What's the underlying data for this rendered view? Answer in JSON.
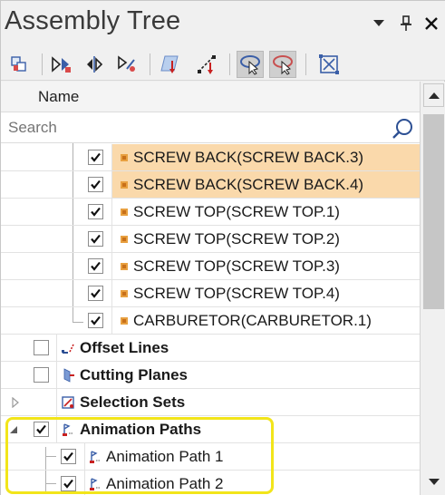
{
  "window": {
    "title": "Assembly Tree",
    "menu_icon": "dropdown-arrow-icon",
    "pin_icon": "pin-icon",
    "close_icon": "close-icon"
  },
  "toolbar": {
    "tools": [
      "isolate-parts-icon",
      "next-level-icon",
      "move-parts-icon",
      "tree-options-icon",
      "plane-section-icon",
      "path-points-icon",
      "select-mode-icon",
      "deselect-mode-icon",
      "fit-view-icon"
    ]
  },
  "tree": {
    "column_header": "Name",
    "search_placeholder": "Search",
    "rows": [
      {
        "label": "SCREW BACK(SCREW BACK.3)",
        "checked": true,
        "highlighted": true
      },
      {
        "label": "SCREW BACK(SCREW BACK.4)",
        "checked": true,
        "highlighted": true
      },
      {
        "label": "SCREW TOP(SCREW TOP.1)",
        "checked": true,
        "highlighted": false
      },
      {
        "label": "SCREW TOP(SCREW TOP.2)",
        "checked": true,
        "highlighted": false
      },
      {
        "label": "SCREW TOP(SCREW TOP.3)",
        "checked": true,
        "highlighted": false
      },
      {
        "label": "SCREW TOP(SCREW TOP.4)",
        "checked": true,
        "highlighted": false
      },
      {
        "label": "CARBURETOR(CARBURETOR.1)",
        "checked": true,
        "highlighted": false
      },
      {
        "label": "Offset Lines",
        "checked": false
      },
      {
        "label": "Cutting Planes",
        "checked": false
      },
      {
        "label": "Selection Sets"
      },
      {
        "label": "Animation Paths",
        "checked": true,
        "expanded": true
      },
      {
        "label": "Animation Path 1",
        "checked": true
      },
      {
        "label": "Animation Path 2",
        "checked": true
      }
    ]
  },
  "colors": {
    "selection_highlight": "#fad9ab",
    "callout_outline": "#f2e51a",
    "part_icon": "#e8a040"
  }
}
